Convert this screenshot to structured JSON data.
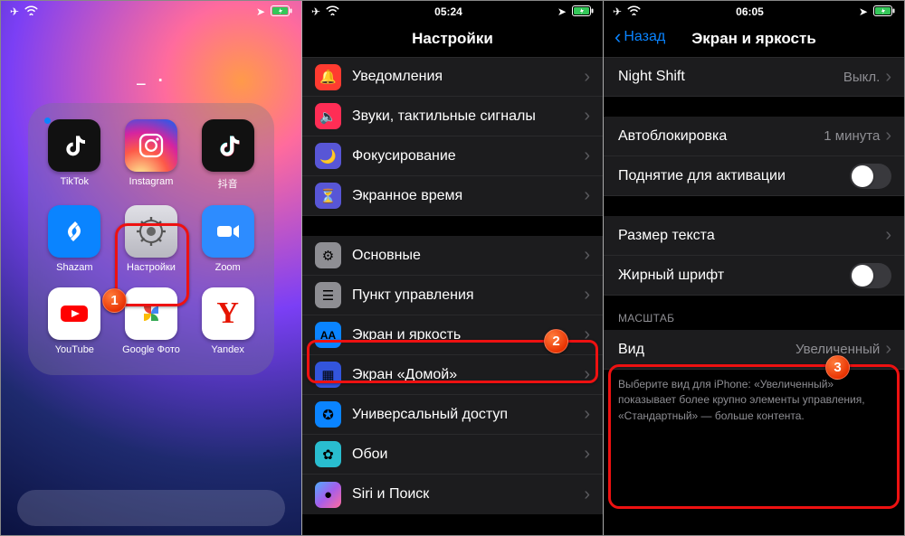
{
  "panel1": {
    "page_indicator": "_ .",
    "apps": [
      {
        "label": "TikTok",
        "dot": true
      },
      {
        "label": "Instagram"
      },
      {
        "label": "抖音"
      },
      {
        "label": "Shazam"
      },
      {
        "label": "Настройки"
      },
      {
        "label": "Zoom"
      },
      {
        "label": "YouTube"
      },
      {
        "label": "Google Фото"
      },
      {
        "label": "Yandex"
      }
    ],
    "callout": "1"
  },
  "panel2": {
    "status_time": "05:24",
    "title": "Настройки",
    "rows_a": [
      {
        "icon_bg": "#ff3b30",
        "glyph": "🔔",
        "label": "Уведомления"
      },
      {
        "icon_bg": "#ff2d55",
        "glyph": "🔈",
        "label": "Звуки, тактильные сигналы"
      },
      {
        "icon_bg": "#5856d6",
        "glyph": "🌙",
        "label": "Фокусирование"
      },
      {
        "icon_bg": "#5856d6",
        "glyph": "⏳",
        "label": "Экранное время"
      }
    ],
    "rows_b": [
      {
        "icon_bg": "#8e8e93",
        "glyph": "⚙",
        "label": "Основные"
      },
      {
        "icon_bg": "#8e8e93",
        "glyph": "☰",
        "label": "Пункт управления"
      },
      {
        "icon_bg": "#0a84ff",
        "glyph": "AA",
        "label": "Экран и яркость"
      },
      {
        "icon_bg": "#3355dd",
        "glyph": "▦",
        "label": "Экран «Домой»"
      },
      {
        "icon_bg": "#0a84ff",
        "glyph": "✪",
        "label": "Универсальный доступ"
      },
      {
        "icon_bg": "#29bdcf",
        "glyph": "✿",
        "label": "Обои"
      },
      {
        "icon_bg": "#111",
        "glyph": "●",
        "label": "Siri и Поиск"
      }
    ],
    "callout": "2"
  },
  "panel3": {
    "status_time": "06:05",
    "back": "Назад",
    "title": "Экран и яркость",
    "night_shift": {
      "label": "Night Shift",
      "value": "Выкл."
    },
    "autolock": {
      "label": "Автоблокировка",
      "value": "1 минута"
    },
    "raise": {
      "label": "Поднятие для активации"
    },
    "text_size": {
      "label": "Размер текста"
    },
    "bold": {
      "label": "Жирный шрифт"
    },
    "scale_header": "МАСШТАБ",
    "view": {
      "label": "Вид",
      "value": "Увеличенный"
    },
    "footer": "Выберите вид для iPhone: «Увеличенный» показывает более крупно элементы управления, «Стандартный» — больше контента.",
    "callout": "3"
  }
}
